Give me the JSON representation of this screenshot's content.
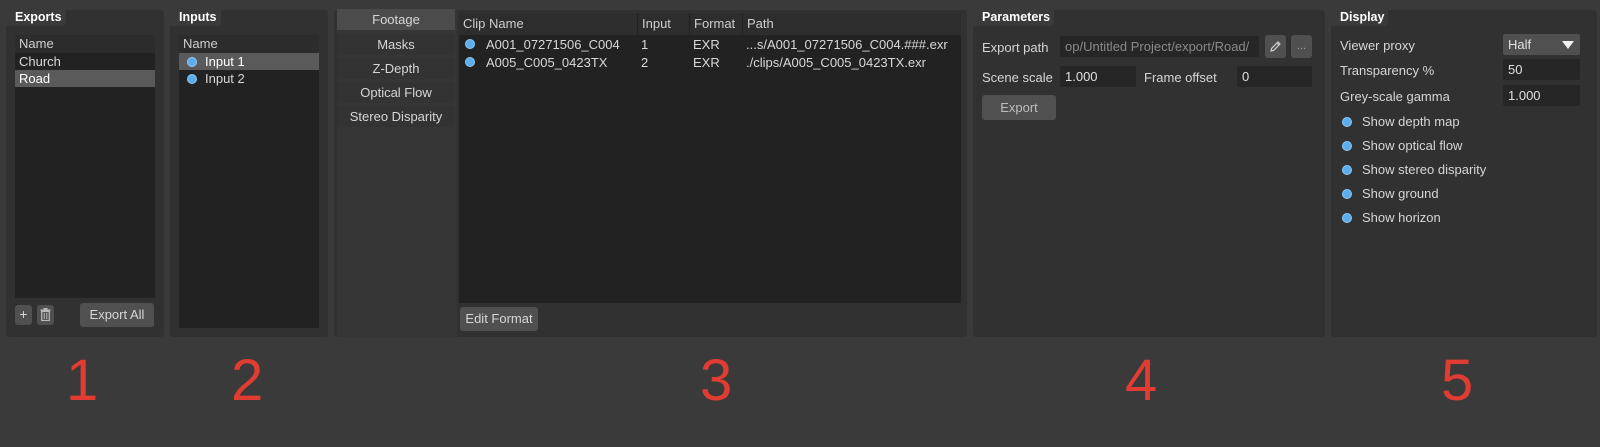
{
  "exports": {
    "title": "Exports",
    "header": "Name",
    "items": [
      "Church",
      "Road"
    ],
    "selected": 1,
    "add_label": "+",
    "export_all_label": "Export All"
  },
  "inputs": {
    "title": "Inputs",
    "header": "Name",
    "items": [
      "Input 1",
      "Input 2"
    ],
    "selected": 0
  },
  "tabs": [
    "Footage",
    "Masks",
    "Z-Depth",
    "Optical Flow",
    "Stereo Disparity"
  ],
  "clips": {
    "headers": [
      "Clip Name",
      "Input",
      "Format",
      "Path"
    ],
    "rows": [
      [
        "A001_07271506_C004",
        "1",
        "EXR",
        "...s/A001_07271506_C004.###.exr"
      ],
      [
        "A005_C005_0423TX",
        "2",
        "EXR",
        "./clips/A005_C005_0423TX.exr"
      ]
    ],
    "edit_format_label": "Edit Format"
  },
  "parameters": {
    "title": "Parameters",
    "export_path_label": "Export path",
    "export_path_value": "op/Untitled Project/export/Road/",
    "browse_label": "...",
    "scene_scale_label": "Scene scale",
    "scene_scale_value": "1.000",
    "frame_offset_label": "Frame offset",
    "frame_offset_value": "0",
    "export_label": "Export"
  },
  "display": {
    "title": "Display",
    "viewer_proxy_label": "Viewer proxy",
    "viewer_proxy_value": "Half",
    "transparency_label": "Transparency %",
    "transparency_value": "50",
    "gamma_label": "Grey-scale gamma",
    "gamma_value": "1.000",
    "options": [
      "Show depth map",
      "Show optical flow",
      "Show stereo disparity",
      "Show ground",
      "Show horizon"
    ]
  },
  "annotations": [
    "1",
    "2",
    "3",
    "4",
    "5"
  ],
  "colors": {
    "accent": "#5cadec",
    "annotation": "#e03c31",
    "selection": "#5a5a5a"
  }
}
